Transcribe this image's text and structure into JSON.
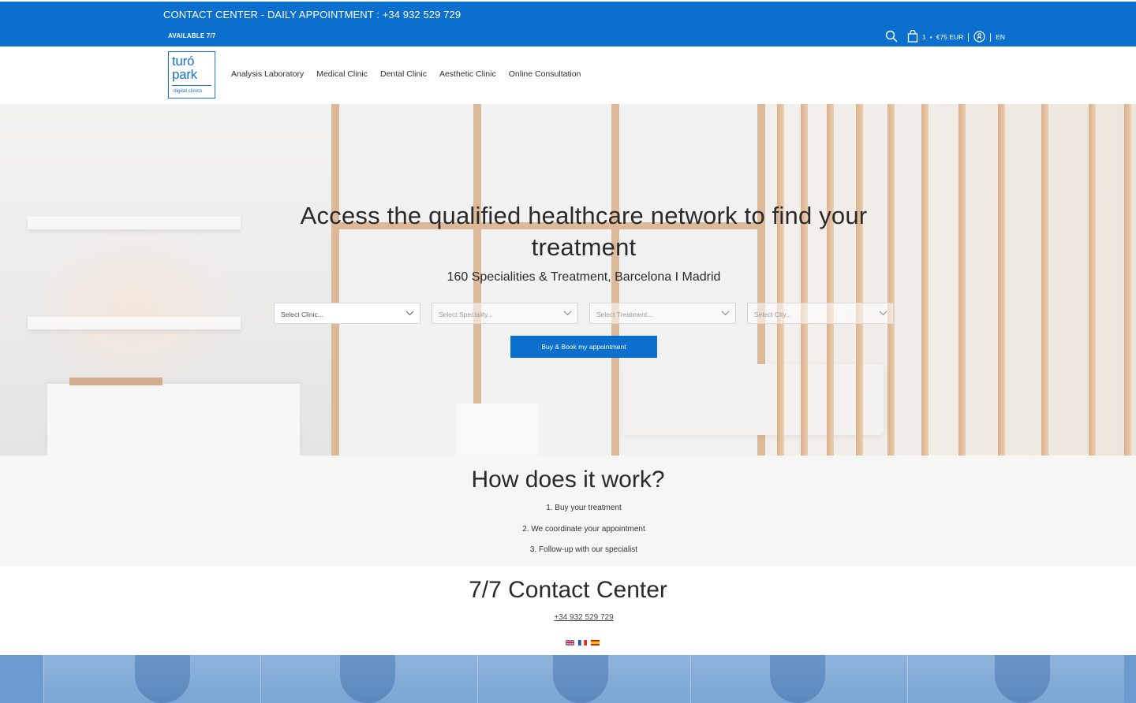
{
  "topbar": {
    "contact_text": "CONTACT CENTER - DAILY APPOINTMENT : +34 932 529 729",
    "available": "AVAILABLE 7/7",
    "cart_count": "1",
    "cart_total": "€75 EUR",
    "language": "EN",
    "icons": [
      "search-icon",
      "cart-icon",
      "account-icon"
    ]
  },
  "logo": {
    "line1": "turó",
    "line2": "park",
    "line3": "digital clinics"
  },
  "nav": {
    "items": [
      {
        "label": "Analysis Laboratory"
      },
      {
        "label": "Medical Clinic"
      },
      {
        "label": "Dental Clinic"
      },
      {
        "label": "Aesthetic Clinic"
      },
      {
        "label": "Online Consultation"
      }
    ]
  },
  "hero": {
    "title": "Access the qualified healthcare network to find your treatment",
    "subtitle": "160 Specialities & Treatment, Barcelona I Madrid",
    "selects": [
      {
        "value": "Select Clinic..."
      },
      {
        "value": "Select Speciality..."
      },
      {
        "value": "Select Treatment..."
      },
      {
        "value": "Select City..."
      }
    ],
    "book_button": "Buy & Book my appointment"
  },
  "how": {
    "title": "How does it work?",
    "steps": [
      "1. Buy your treatment",
      "2. We coordinate your appointment",
      "3. Follow-up with our specialist"
    ]
  },
  "contact_center": {
    "title": "7/7 Contact Center",
    "phone": "+34 932 529 729",
    "flags": [
      "uk-flag-icon",
      "france-flag-icon",
      "spain-flag-icon"
    ]
  },
  "colors": {
    "brand_blue": "#0a6fcd",
    "team_blue": "#6c9ccf"
  }
}
